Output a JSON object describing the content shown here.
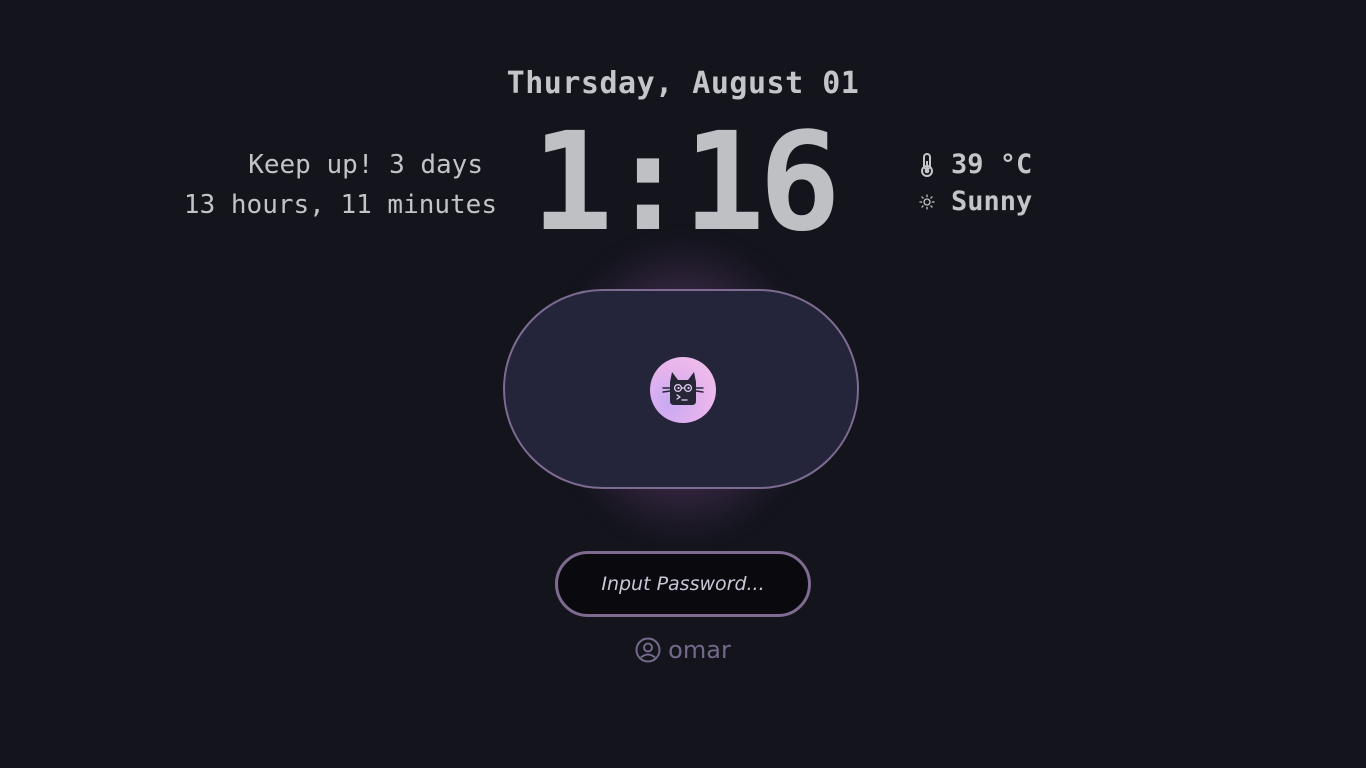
{
  "date": "Thursday, August 01",
  "countdown": {
    "line1": "Keep up! 3 days",
    "line2": "13 hours, 11 minutes"
  },
  "clock": "1:16",
  "weather": {
    "temperature": "39 °C",
    "condition": "Sunny",
    "temperature_icon": "thermometer-icon",
    "condition_icon": "sun-icon"
  },
  "avatar": {
    "icon": "cat-terminal-icon"
  },
  "password": {
    "placeholder": "Input Password..."
  },
  "user": {
    "name": "omar",
    "icon": "user-circle-icon"
  },
  "colors": {
    "background": "#13141c",
    "card": "#24253a",
    "accent": "#7d6b92",
    "glow": "#be78c8",
    "text": "#c2c3c6",
    "user_text": "#74698a"
  }
}
